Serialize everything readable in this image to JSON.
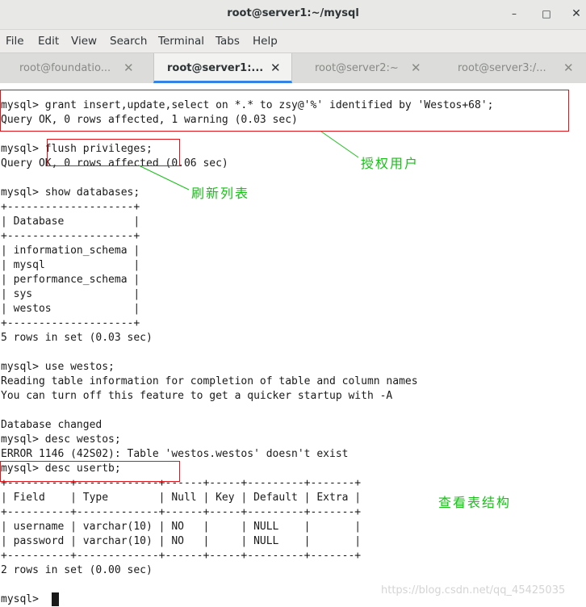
{
  "window": {
    "title": "root@server1:~/mysql",
    "minimize": "–",
    "maximize": "□",
    "close": "✕"
  },
  "menu": [
    "File",
    "Edit",
    "View",
    "Search",
    "Terminal",
    "Tabs",
    "Help"
  ],
  "tabs": [
    {
      "label": "root@foundatio...",
      "close": "✕",
      "active": false
    },
    {
      "label": "root@server1:...",
      "close": "✕",
      "active": true
    },
    {
      "label": "root@server2:~",
      "close": "✕",
      "active": false
    },
    {
      "label": "root@server3:/...",
      "close": "✕",
      "active": false
    }
  ],
  "terminal": {
    "lines": [
      "mysql> grant insert,update,select on *.* to zsy@'%' identified by 'Westos+68';",
      "Query OK, 0 rows affected, 1 warning (0.03 sec)",
      "",
      "mysql> flush privileges;",
      "Query OK, 0 rows affected (0.06 sec)",
      "",
      "mysql> show databases;",
      "+--------------------+",
      "| Database           |",
      "+--------------------+",
      "| information_schema |",
      "| mysql              |",
      "| performance_schema |",
      "| sys                |",
      "| westos             |",
      "+--------------------+",
      "5 rows in set (0.03 sec)",
      "",
      "mysql> use westos;",
      "Reading table information for completion of table and column names",
      "You can turn off this feature to get a quicker startup with -A",
      "",
      "Database changed",
      "mysql> desc westos;",
      "ERROR 1146 (42S02): Table 'westos.westos' doesn't exist",
      "mysql> desc usertb;",
      "+----------+-------------+------+-----+---------+-------+",
      "| Field    | Type        | Null | Key | Default | Extra |",
      "+----------+-------------+------+-----+---------+-------+",
      "| username | varchar(10) | NO   |     | NULL    |       |",
      "| password | varchar(10) | NO   |     | NULL    |       |",
      "+----------+-------------+------+-----+---------+-------+",
      "2 rows in set (0.00 sec)",
      "",
      "mysql> "
    ]
  },
  "annotations": {
    "grant_note": "授权用户",
    "flush_note": "刷新列表",
    "desc_note": "查看表结构",
    "box_color": "#e0141b",
    "note_color": "#18c018"
  },
  "watermark": "https://blog.csdn.net/qq_45425035"
}
